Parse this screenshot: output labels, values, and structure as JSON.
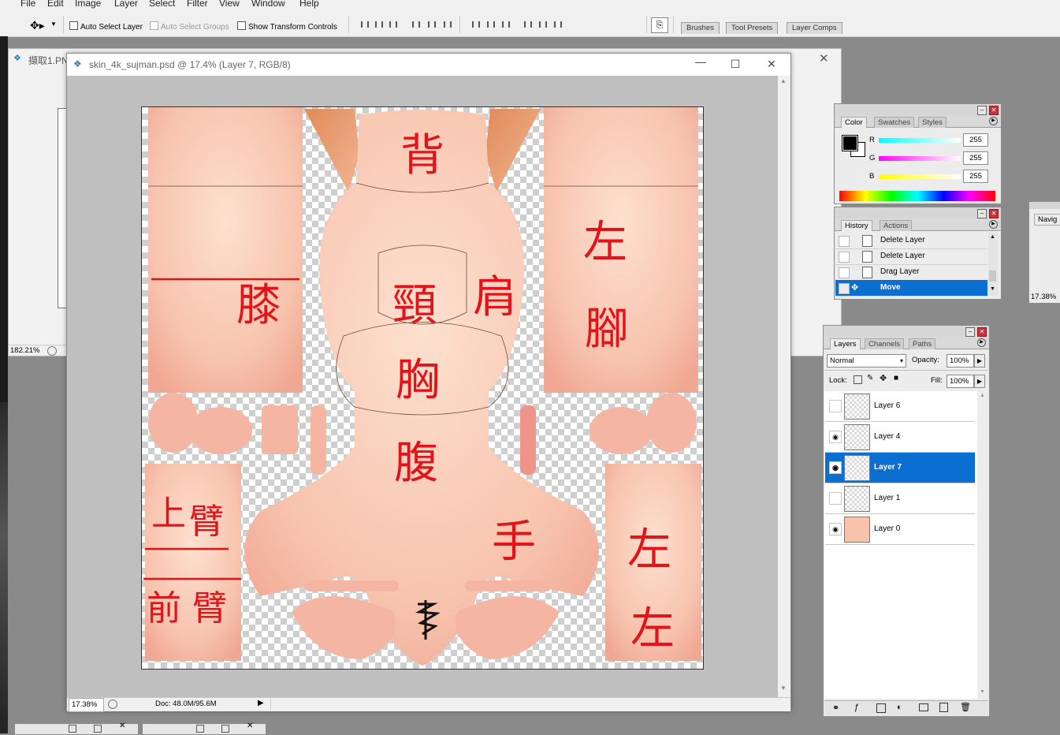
{
  "menu": [
    "File",
    "Edit",
    "Image",
    "Layer",
    "Select",
    "Filter",
    "View",
    "Window",
    "Help"
  ],
  "options": {
    "auto_select_layer": "Auto Select Layer",
    "auto_select_groups": "Auto Select Groups",
    "show_transform_controls": "Show Transform Controls"
  },
  "well_tabs": [
    "Brushes",
    "Tool Presets",
    "Layer Comps"
  ],
  "behind_window": {
    "title": "擷取1.PN",
    "zoom": "182.21%"
  },
  "document": {
    "title": "skin_4k_sujman.psd @ 17.4% (Layer 7, RGB/8)",
    "zoom": "17.38%",
    "doc_size": "Doc: 48.0M/95.6M",
    "annotations": [
      "背",
      "左",
      "腳",
      "膝",
      "頸",
      "肩",
      "胸",
      "腹",
      "上",
      "臂",
      "前",
      "臂",
      "手",
      "左",
      "左",
      "手"
    ]
  },
  "color_panel": {
    "tabs": [
      "Color",
      "Swatches",
      "Styles"
    ],
    "channels": [
      {
        "label": "R",
        "value": "255"
      },
      {
        "label": "G",
        "value": "255"
      },
      {
        "label": "B",
        "value": "255"
      }
    ]
  },
  "history_panel": {
    "tabs": [
      "History",
      "Actions"
    ],
    "items": [
      "Delete Layer",
      "Delete Layer",
      "Drag Layer",
      "Move"
    ]
  },
  "navigator_panel": {
    "tab": "Navig",
    "zoom": "17.38%"
  },
  "layers_panel": {
    "tabs": [
      "Layers",
      "Channels",
      "Paths"
    ],
    "blend_mode": "Normal",
    "opacity_label": "Opacity:",
    "opacity": "100%",
    "lock_label": "Lock:",
    "fill_label": "Fill:",
    "fill": "100%",
    "layers": [
      {
        "name": "Layer 6",
        "visible": false
      },
      {
        "name": "Layer 4",
        "visible": true
      },
      {
        "name": "Layer 7",
        "visible": true,
        "selected": true
      },
      {
        "name": "Layer 1",
        "visible": false
      },
      {
        "name": "Layer 0",
        "visible": true
      }
    ]
  },
  "colors": {
    "selection": "#0a6fd1",
    "skin": "#f6c4ae",
    "ink": "#e0141a"
  }
}
